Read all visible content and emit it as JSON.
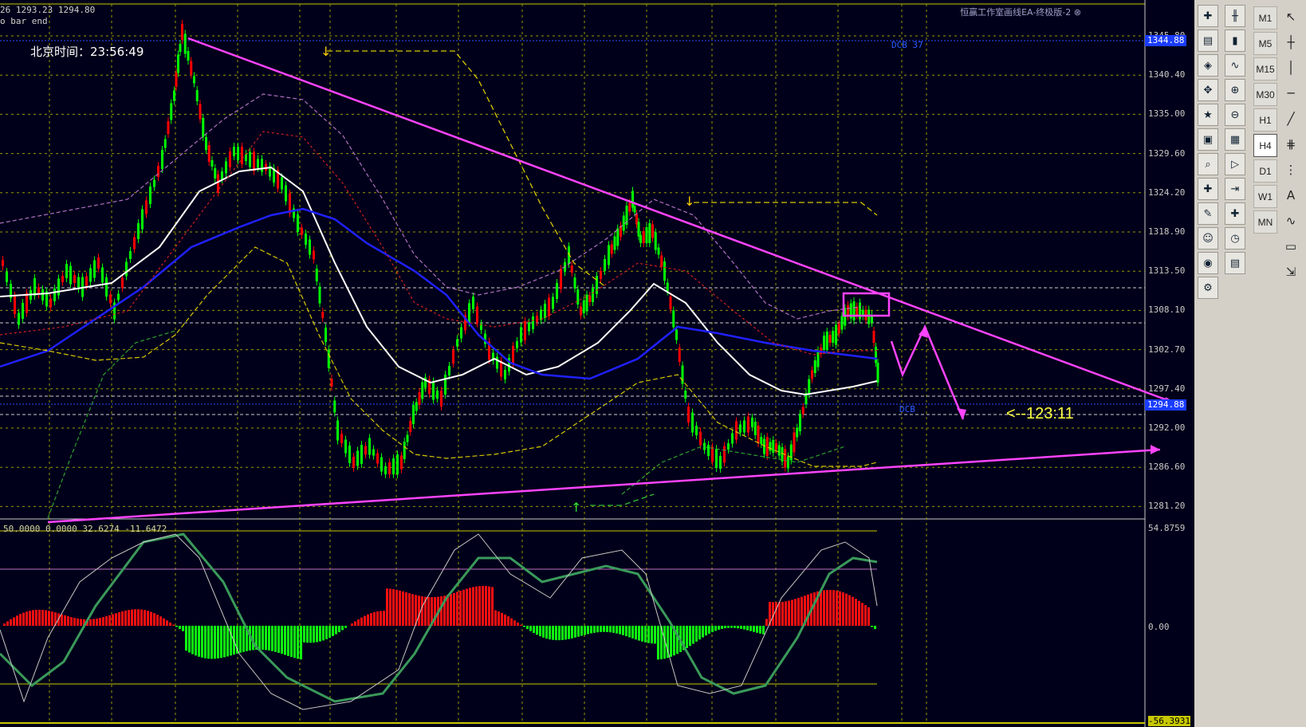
{
  "header": {
    "price_line": "26 1293.23 1294.80",
    "bar_end": "o bar end",
    "beijing_time": "北京时间：23:56:49",
    "ea_title": "恒赢工作室画线EA-终极版-2 ⊗"
  },
  "price_axis": {
    "labels": [
      "1345.80",
      "1340.40",
      "1335.00",
      "1329.60",
      "1324.20",
      "1318.90",
      "1313.50",
      "1308.10",
      "1302.70",
      "1297.40",
      "1292.00",
      "1286.60",
      "1281.20"
    ],
    "current_boxes": [
      "1344.88",
      "1294.88"
    ]
  },
  "level_tags": {
    "top": "DCB 37",
    "bottom": "DCB"
  },
  "countdown": "<--123:11",
  "oscillator": {
    "params": "50.0000 0.0000 32.6274 -11.6472",
    "axis_top": "54.8759",
    "axis_mid": "0.00",
    "axis_bottom": "-56.3931"
  },
  "toolbar": {
    "timeframes": [
      "M1",
      "M5",
      "M15",
      "M30",
      "H1",
      "H4",
      "D1",
      "W1",
      "MN"
    ],
    "active_timeframe": "H4",
    "tool_col1_icons": [
      "new-chart-icon",
      "profiles-icon",
      "market-watch-icon",
      "navigator-icon",
      "favorites-icon",
      "terminal-icon",
      "strategy-tester-icon",
      "new-order-icon",
      "metaeditor-icon",
      "expert-icon",
      "signals-icon",
      "options-icon"
    ],
    "tool_col2_icons": [
      "bar-chart-icon",
      "candle-chart-icon",
      "line-chart-icon",
      "zoom-in-icon",
      "zoom-out-icon",
      "tile-windows-icon",
      "autoscroll-icon",
      "chart-shift-icon",
      "indicators-icon",
      "periods-icon",
      "templates-icon"
    ],
    "draw_tools": [
      "↖",
      "┼",
      "│",
      "─",
      "╱",
      "⋕",
      "⋮",
      "A",
      "∿",
      "▭",
      "⇲"
    ]
  },
  "colors": {
    "background": "#00001a",
    "bull": "#00ff00",
    "bear": "#ff0000",
    "trendline": "#ff44ff",
    "grid": "#c8c800"
  }
}
